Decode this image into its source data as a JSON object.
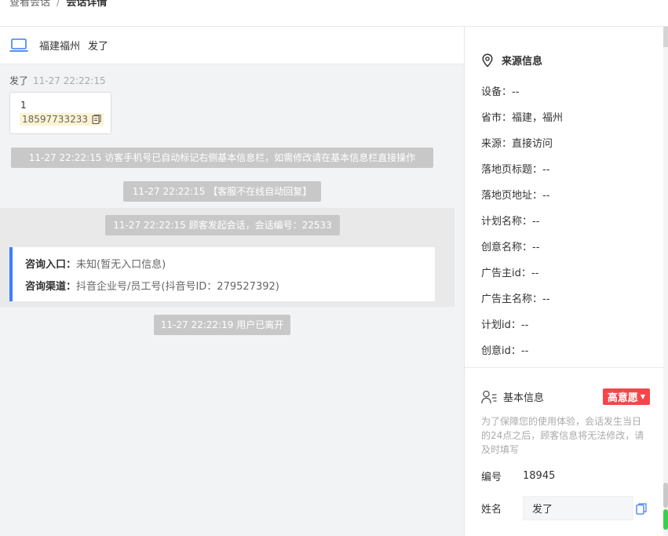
{
  "breadcrumb": {
    "parent": "查看会话",
    "separator": "/",
    "current": "会话详情"
  },
  "chat": {
    "header": {
      "device_icon": "laptop-icon",
      "location": "福建福州",
      "visitor": "发了"
    },
    "message": {
      "sender": "发了",
      "time": "11-27 22:22:15",
      "line1": "1",
      "phone": "18597733233",
      "copy_icon": "copy-icon"
    },
    "system": [
      "11-27 22:22:15 访客手机号已自动标记右侧基本信息栏，如需修改请在基本信息栏直接操作",
      "11-27 22:22:15 【客服不在线自动回复】",
      "11-27 22:22:15 顾客发起会话，会话编号：22533",
      "11-27 22:22:19 用户已离开"
    ],
    "entry": {
      "entry_label": "咨询入口：",
      "entry_value": "未知(暂无入口信息)",
      "channel_label": "咨询渠道：",
      "channel_value": "抖音企业号/员工号(抖音号ID：279527392)"
    }
  },
  "side": {
    "source": {
      "title": "来源信息",
      "icon": "location-pin-icon",
      "items": [
        {
          "label": "设备：",
          "value": "--"
        },
        {
          "label": "省市：",
          "value": "福建，福州"
        },
        {
          "label": "来源：",
          "value": "直接访问"
        },
        {
          "label": "落地页标题：",
          "value": "--"
        },
        {
          "label": "落地页地址：",
          "value": "--"
        },
        {
          "label": "计划名称：",
          "value": "--"
        },
        {
          "label": "创意名称：",
          "value": "--"
        },
        {
          "label": "广告主id：",
          "value": "--"
        },
        {
          "label": "广告主名称：",
          "value": "--"
        },
        {
          "label": "计划id：",
          "value": "--"
        },
        {
          "label": "创意id：",
          "value": "--"
        }
      ]
    },
    "basic": {
      "title": "基本信息",
      "icon": "user-list-icon",
      "intent": "高意愿",
      "intent_color": "#f4464a",
      "notice": "为了保障您的使用体验，会话发生当日的24点之后，顾客信息将无法修改，请及时填写",
      "id_label": "编号",
      "id_value": "18945",
      "name_label": "姓名",
      "name_value": "发了"
    }
  },
  "colors": {
    "accent": "#3d7eff",
    "system_msg_bg": "#c8c8c8",
    "phone_highlight": "#fdf3d2"
  }
}
